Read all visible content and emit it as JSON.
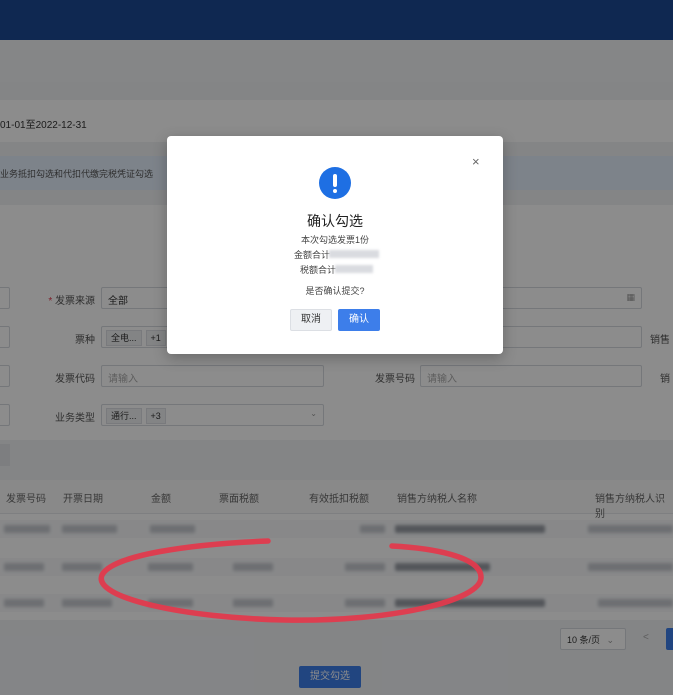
{
  "page": {
    "date_range": "01-01至2022-12-31",
    "notice": "业务抵扣勾选和代扣代缴完税凭证勾选"
  },
  "filters": {
    "invoice_source_label": "发票来源",
    "invoice_source_value": "全部",
    "invoice_type_label": "票种",
    "invoice_type_tag": "全电...",
    "invoice_type_more": "+1",
    "invoice_code_label": "发票代码",
    "invoice_code_placeholder": "请输入",
    "invoice_number_label": "发票号码",
    "invoice_number_placeholder": "请输入",
    "business_type_label": "业务类型",
    "business_type_tag": "通行...",
    "business_type_more": "+3",
    "seller_label_partial": "销售",
    "right_label_partial": "销"
  },
  "table": {
    "headers": [
      "发票号码",
      "开票日期",
      "金额",
      "票面税额",
      "有效抵扣税额",
      "销售方纳税人名称",
      "销售方纳税人识别"
    ]
  },
  "pagination": {
    "page_size": "10 条/页",
    "prev": "<"
  },
  "submit_label": "提交勾选",
  "modal": {
    "icon": "exclamation-icon",
    "title": "确认勾选",
    "line1": "本次勾选发票1份",
    "line2_prefix": "金额合计",
    "line3_prefix": "税额合计",
    "question": "是否确认提交?",
    "cancel": "取消",
    "confirm": "确认",
    "close": "×"
  },
  "colors": {
    "brand": "#1d4a94",
    "primary": "#3d7eea",
    "annotation": "#e23a4d"
  }
}
